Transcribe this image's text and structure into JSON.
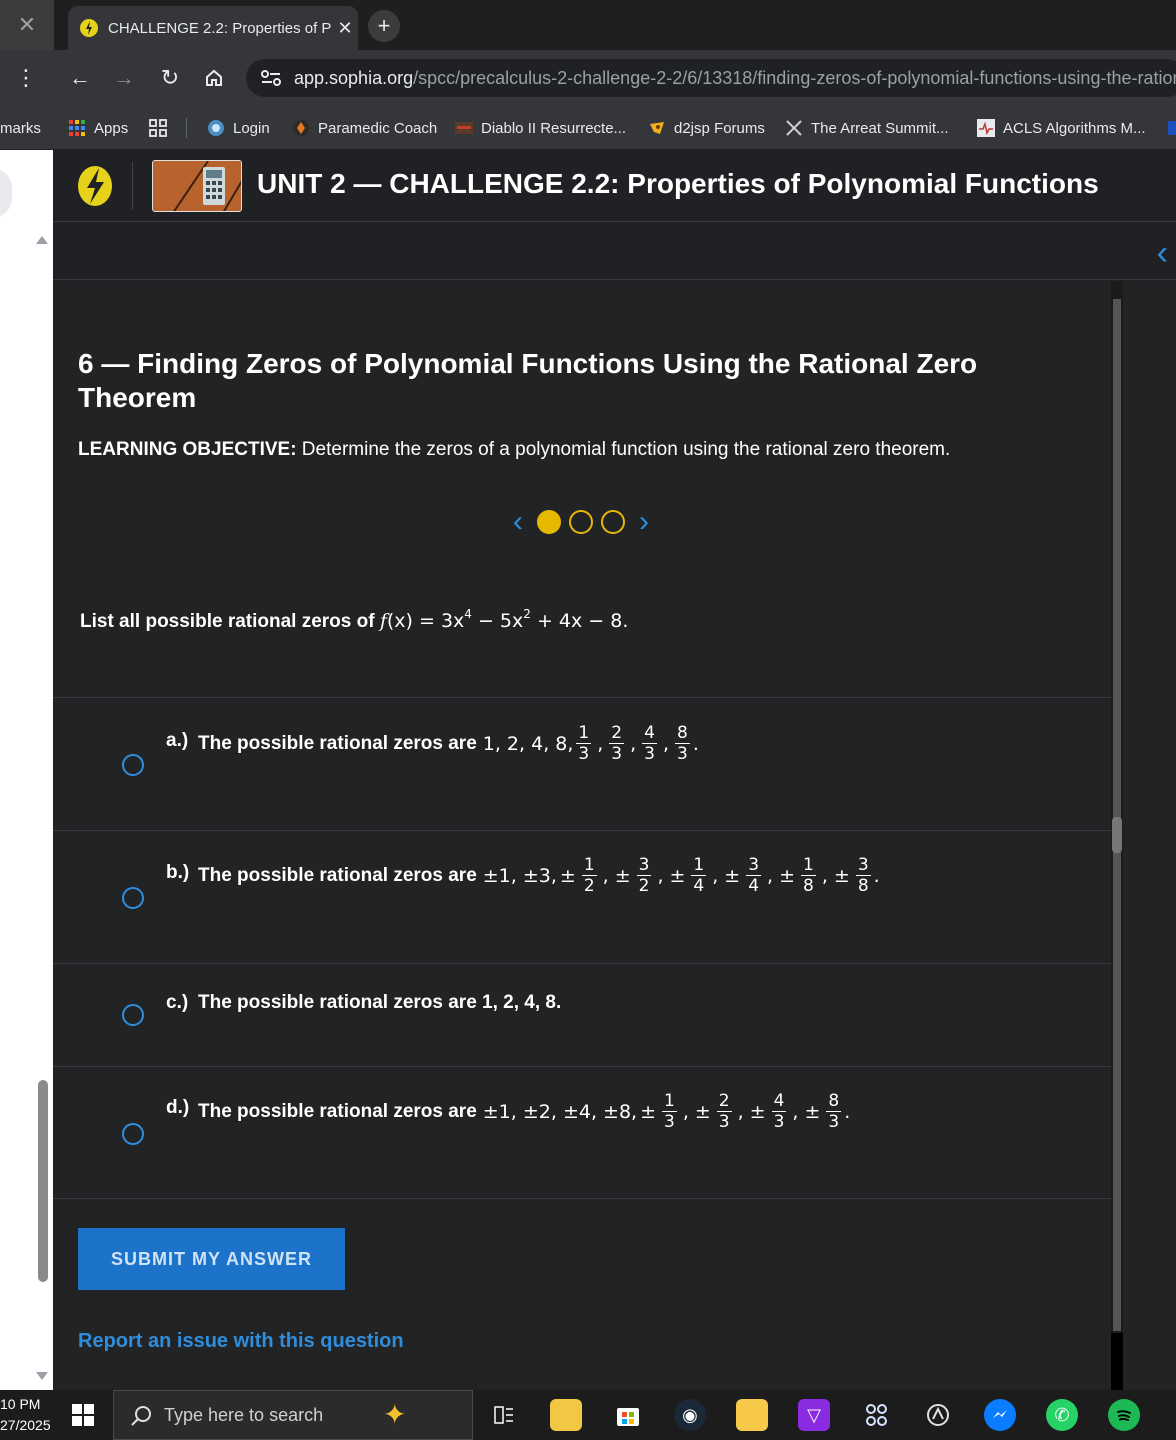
{
  "browser": {
    "tab_title": "CHALLENGE 2.2: Properties of P",
    "tab_close": "✕",
    "new_tab": "+",
    "url_host": "app.sophia.org",
    "url_path": "/spcc/precalculus-2-challenge-2-2/6/13318/finding-zeros-of-polynomial-functions-using-the-ration",
    "bookmarks_cut": "marks",
    "bookmarks": [
      {
        "label": "Apps"
      },
      {
        "label": "Login"
      },
      {
        "label": "Paramedic Coach"
      },
      {
        "label": "Diablo II Resurrecte..."
      },
      {
        "label": "d2jsp Forums"
      },
      {
        "label": "The Arreat Summit..."
      },
      {
        "label": "ACLS Algorithms M..."
      }
    ]
  },
  "header": {
    "unit_title": "UNIT 2 — CHALLENGE 2.2: Properties of Polynomial Functions"
  },
  "question": {
    "title": "6 — Finding Zeros of Polynomial Functions Using the Rational Zero Theorem",
    "objective_label": "LEARNING OBJECTIVE:",
    "objective_text": " Determine the zeros of a polynomial function using the rational zero theorem.",
    "prompt": "List all possible rational zeros of ",
    "function": {
      "f": "f",
      "x": "(x) = 3x",
      "e1": "4",
      "mid": " − 5x",
      "e2": "2",
      "tail": " + 4x − 8."
    },
    "pager": {
      "pages": 3,
      "current": 1
    }
  },
  "choices": [
    {
      "letter": "a.)",
      "lead": "The possible rational zeros are",
      "ints": "1, 2, 4, 8,",
      "sign": "",
      "fracs": [
        [
          "1",
          "3"
        ],
        [
          "2",
          "3"
        ],
        [
          "4",
          "3"
        ],
        [
          "8",
          "3"
        ]
      ]
    },
    {
      "letter": "b.)",
      "lead": "The possible rational zeros are",
      "ints": "±1, ±3,",
      "sign": "±",
      "fracs": [
        [
          "1",
          "2"
        ],
        [
          "3",
          "2"
        ],
        [
          "1",
          "4"
        ],
        [
          "3",
          "4"
        ],
        [
          "1",
          "8"
        ],
        [
          "3",
          "8"
        ]
      ]
    },
    {
      "letter": "c.)",
      "lead": "The possible rational zeros are 1, 2, 4, 8."
    },
    {
      "letter": "d.)",
      "lead": "The possible rational zeros are",
      "ints": "±1, ±2, ±4, ±8,",
      "sign": "±",
      "fracs": [
        [
          "1",
          "3"
        ],
        [
          "2",
          "3"
        ],
        [
          "4",
          "3"
        ],
        [
          "8",
          "3"
        ]
      ]
    }
  ],
  "actions": {
    "submit": "SUBMIT MY ANSWER",
    "report": "Report an issue with this question"
  },
  "taskbar": {
    "time": "10 PM",
    "date": "27/2025",
    "search_placeholder": "Type here to search"
  },
  "colors": {
    "accent": "#2f8ddb",
    "brand_yellow": "#e6b800",
    "submit": "#1d73c9"
  }
}
